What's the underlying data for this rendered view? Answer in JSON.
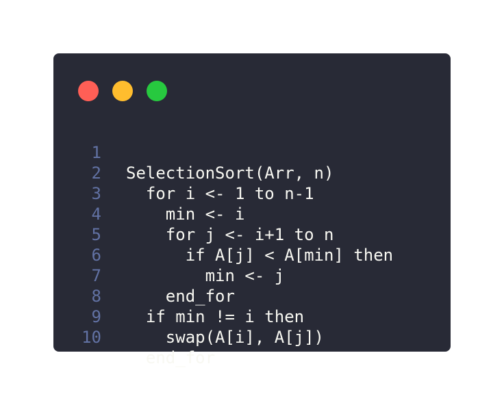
{
  "window": {
    "dots": [
      {
        "name": "close",
        "color": "#ff5f56"
      },
      {
        "name": "minimize",
        "color": "#ffbd2e"
      },
      {
        "name": "zoom",
        "color": "#27c93f"
      }
    ]
  },
  "code": {
    "lines": [
      {
        "number": "1",
        "text": "SelectionSort(Arr, n)"
      },
      {
        "number": "2",
        "text": "  for i <- 1 to n-1"
      },
      {
        "number": "3",
        "text": "    min <- i"
      },
      {
        "number": "4",
        "text": "    for j <- i+1 to n"
      },
      {
        "number": "5",
        "text": "      if A[j] < A[min] then"
      },
      {
        "number": "6",
        "text": "        min <- j"
      },
      {
        "number": "7",
        "text": "    end_for"
      },
      {
        "number": "8",
        "text": "  if min != i then"
      },
      {
        "number": "9",
        "text": "    swap(A[i], A[j])"
      },
      {
        "number": "10",
        "text": "  end_for"
      }
    ]
  }
}
